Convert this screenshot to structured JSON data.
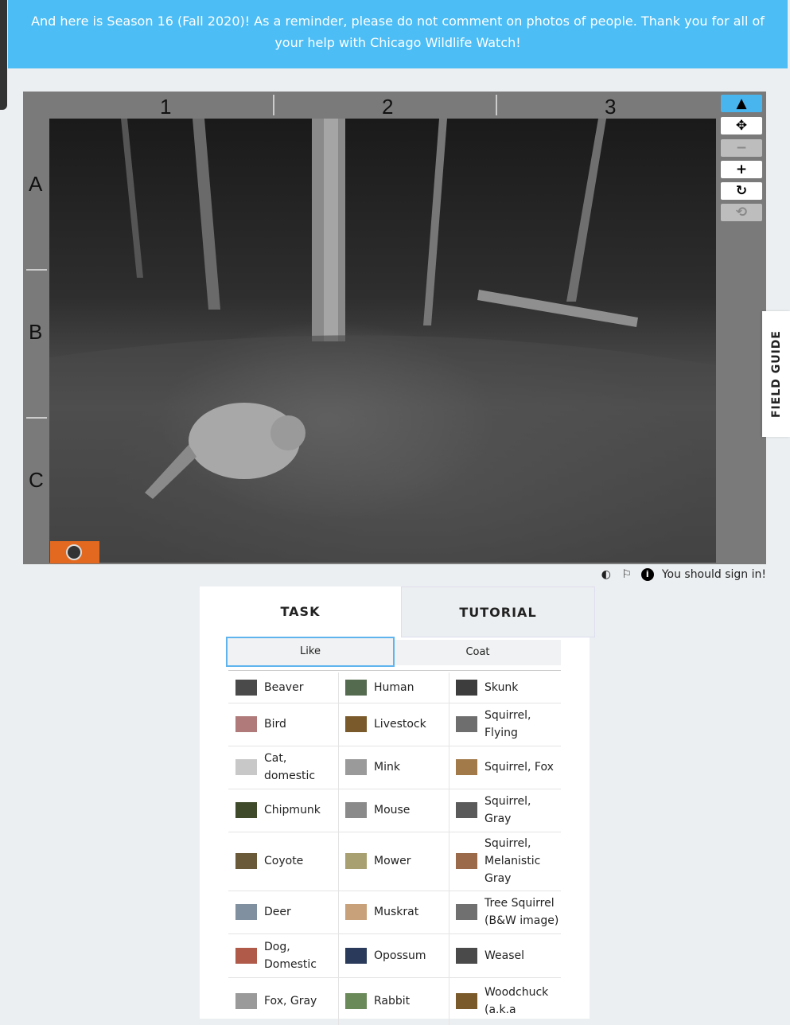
{
  "banner": {
    "text": "And here is Season 16 (Fall 2020)! As a reminder, please do not comment on photos of people. Thank you for all of your help with Chicago Wildlife Watch!"
  },
  "viewer": {
    "columns": [
      "1",
      "2",
      "3"
    ],
    "rows": [
      "A",
      "B",
      "C"
    ]
  },
  "toolbar": {
    "annotate": "▲",
    "pan": "✥",
    "zoom_out": "−",
    "zoom_in": "+",
    "rotate": "↻",
    "reset": "⟲"
  },
  "field_guide": {
    "label": "FIELD GUIDE"
  },
  "meta": {
    "invert_icon": "◐",
    "flag_icon": "⚐",
    "info_icon": "i",
    "sign_in": "You should sign in!"
  },
  "tabs": {
    "task": "TASK",
    "tutorial": "TUTORIAL"
  },
  "filters": {
    "like": "Like",
    "coat": "Coat"
  },
  "species": [
    {
      "col": 0,
      "row": 0,
      "label": "Beaver",
      "thumb": "#4a4a4a"
    },
    {
      "col": 1,
      "row": 0,
      "label": "Human",
      "thumb": "#556b4f"
    },
    {
      "col": 2,
      "row": 0,
      "label": "Skunk",
      "thumb": "#3d3d3d"
    },
    {
      "col": 0,
      "row": 1,
      "label": "Bird",
      "thumb": "#b07a7a"
    },
    {
      "col": 1,
      "row": 1,
      "label": "Livestock",
      "thumb": "#7a5a2a"
    },
    {
      "col": 2,
      "row": 1,
      "label": "Squirrel, Flying",
      "thumb": "#6e6e6e"
    },
    {
      "col": 0,
      "row": 2,
      "label": "Cat, domestic",
      "thumb": "#c8c8c8"
    },
    {
      "col": 1,
      "row": 2,
      "label": "Mink",
      "thumb": "#9a9a9a"
    },
    {
      "col": 2,
      "row": 2,
      "label": "Squirrel, Fox",
      "thumb": "#a27a4a"
    },
    {
      "col": 0,
      "row": 3,
      "label": "Chipmunk",
      "thumb": "#3f4a2a"
    },
    {
      "col": 1,
      "row": 3,
      "label": "Mouse",
      "thumb": "#8a8a8a"
    },
    {
      "col": 2,
      "row": 3,
      "label": "Squirrel, Gray",
      "thumb": "#5a5a5a"
    },
    {
      "col": 0,
      "row": 4,
      "label": "Coyote",
      "thumb": "#6a5a3a"
    },
    {
      "col": 1,
      "row": 4,
      "label": "Mower",
      "thumb": "#a8a070"
    },
    {
      "col": 2,
      "row": 4,
      "label": "Squirrel, Melanistic Gray",
      "thumb": "#9a6a4a"
    },
    {
      "col": 0,
      "row": 5,
      "label": "Deer",
      "thumb": "#8090a0"
    },
    {
      "col": 1,
      "row": 5,
      "label": "Muskrat",
      "thumb": "#c8a07a"
    },
    {
      "col": 2,
      "row": 5,
      "label": "Tree Squirrel (B&W image)",
      "thumb": "#707070"
    },
    {
      "col": 0,
      "row": 6,
      "label": "Dog, Domestic",
      "thumb": "#b05a4a"
    },
    {
      "col": 1,
      "row": 6,
      "label": "Opossum",
      "thumb": "#2a3a5a"
    },
    {
      "col": 2,
      "row": 6,
      "label": "Weasel",
      "thumb": "#4a4a4a"
    },
    {
      "col": 0,
      "row": 7,
      "label": "Fox, Gray",
      "thumb": "#9a9a9a"
    },
    {
      "col": 1,
      "row": 7,
      "label": "Rabbit",
      "thumb": "#6a8a5a"
    },
    {
      "col": 2,
      "row": 7,
      "label": "Woodchuck (a.k.a",
      "thumb": "#7a5a2a"
    }
  ]
}
